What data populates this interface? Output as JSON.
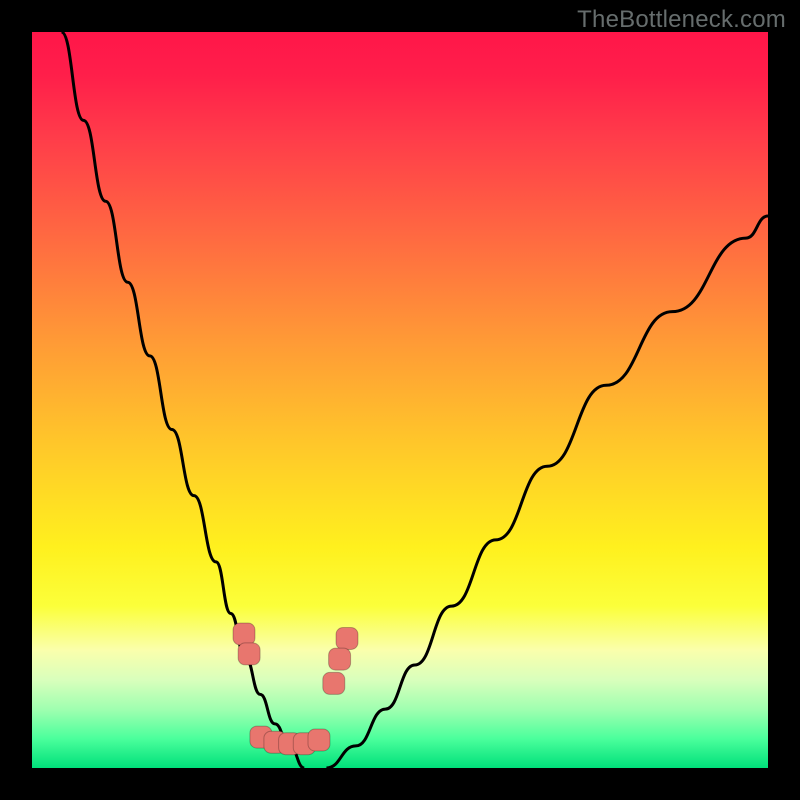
{
  "watermark": {
    "text": "TheBottleneck.com"
  },
  "chart_data": {
    "type": "line",
    "title": "",
    "xlabel": "",
    "ylabel": "",
    "xlim": [
      0,
      100
    ],
    "ylim": [
      0,
      100
    ],
    "series": [
      {
        "name": "left-curve",
        "x": [
          4,
          7,
          10,
          13,
          16,
          19,
          22,
          25,
          27,
          29,
          31,
          33,
          35,
          37
        ],
        "values": [
          100,
          88,
          77,
          66,
          56,
          46,
          37,
          28,
          21,
          15,
          10,
          6,
          3,
          0
        ]
      },
      {
        "name": "right-curve",
        "x": [
          40,
          44,
          48,
          52,
          57,
          63,
          70,
          78,
          87,
          97,
          100
        ],
        "values": [
          0,
          3,
          8,
          14,
          22,
          31,
          41,
          52,
          62,
          72,
          75
        ]
      },
      {
        "name": "bottom-bridge",
        "x": [
          33,
          40
        ],
        "values": [
          0,
          0
        ]
      }
    ],
    "markers": [
      {
        "name": "left-pair-top",
        "x": 28.8,
        "y": 18.2
      },
      {
        "name": "left-pair-bot",
        "x": 29.5,
        "y": 15.5
      },
      {
        "name": "right-triplet-1",
        "x": 42.8,
        "y": 17.6
      },
      {
        "name": "right-triplet-2",
        "x": 41.8,
        "y": 14.8
      },
      {
        "name": "right-triplet-3",
        "x": 41.0,
        "y": 11.5
      },
      {
        "name": "bottom-row-1",
        "x": 31.1,
        "y": 4.2
      },
      {
        "name": "bottom-row-2",
        "x": 33.0,
        "y": 3.5
      },
      {
        "name": "bottom-row-3",
        "x": 35.0,
        "y": 3.3
      },
      {
        "name": "bottom-row-4",
        "x": 37.0,
        "y": 3.3
      },
      {
        "name": "bottom-row-5",
        "x": 39.0,
        "y": 3.8
      }
    ],
    "colors": {
      "curve": "#000000",
      "marker_fill": "#e8766e",
      "gradient_top": "#ff1649",
      "gradient_bottom": "#00e07a"
    }
  }
}
